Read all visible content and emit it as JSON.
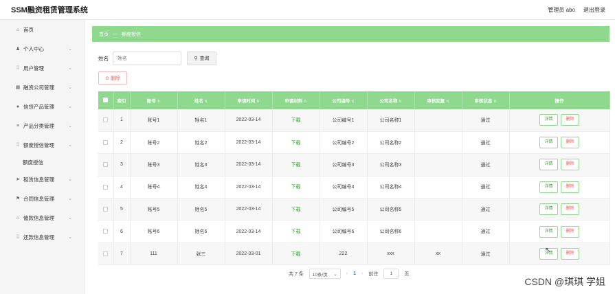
{
  "app": {
    "title": "SSM融资租赁管理系统"
  },
  "topbar": {
    "user": "管理员 abo",
    "logout": "退出登录"
  },
  "sidebar": {
    "items": [
      {
        "label": "首页",
        "icon": "home-icon",
        "glyph": "⌂",
        "chevron": false
      },
      {
        "label": "个人中心",
        "icon": "user-icon",
        "glyph": "♟",
        "chevron": true
      },
      {
        "label": "用户管理",
        "icon": "grid-icon",
        "glyph": "⁞⁞",
        "chevron": true
      },
      {
        "label": "融资公司管理",
        "icon": "building-icon",
        "glyph": "▦",
        "chevron": true
      },
      {
        "label": "信贷产品管理",
        "icon": "location-icon",
        "glyph": "●",
        "chevron": true
      },
      {
        "label": "产品分类管理",
        "icon": "list-icon",
        "glyph": "≡",
        "chevron": true
      },
      {
        "label": "额度授信管理",
        "icon": "grid-icon",
        "glyph": "⁞⁞",
        "chevron": true
      }
    ],
    "sub_item": "额度授信",
    "items2": [
      {
        "label": "租赁信息管理",
        "icon": "send-icon",
        "glyph": "➤",
        "chevron": true
      },
      {
        "label": "合同信息管理",
        "icon": "contract-icon",
        "glyph": "⚑",
        "chevron": true
      },
      {
        "label": "催款信息管理",
        "icon": "bank-icon",
        "glyph": "⌂",
        "chevron": true
      },
      {
        "label": "还款信息管理",
        "icon": "grid-icon",
        "glyph": "⁞⁞",
        "chevron": true
      }
    ]
  },
  "breadcrumb": {
    "home": "首页",
    "separator": "—",
    "current": "额度授信"
  },
  "search": {
    "label": "姓名",
    "placeholder": "姓名",
    "button": "查询"
  },
  "toolbar": {
    "delete_label": "删除"
  },
  "table": {
    "headers": [
      "索引",
      "账号",
      "姓名",
      "申请时间",
      "申请材料",
      "公司编号",
      "公司名称",
      "审核回复",
      "审核状态",
      "操作"
    ],
    "rows": [
      {
        "index": "1",
        "account": "账号1",
        "name": "姓名1",
        "time": "2022-03-14",
        "material": "下载",
        "company_no": "公司编号1",
        "company_name": "公司名称1",
        "reply": "",
        "status": "通过"
      },
      {
        "index": "2",
        "account": "账号2",
        "name": "姓名2",
        "time": "2022-03-14",
        "material": "下载",
        "company_no": "公司编号2",
        "company_name": "公司名称2",
        "reply": "",
        "status": "通过"
      },
      {
        "index": "3",
        "account": "账号3",
        "name": "姓名3",
        "time": "2022-03-14",
        "material": "下载",
        "company_no": "公司编号3",
        "company_name": "公司名称3",
        "reply": "",
        "status": "通过"
      },
      {
        "index": "4",
        "account": "账号4",
        "name": "姓名4",
        "time": "2022-03-14",
        "material": "下载",
        "company_no": "公司编号4",
        "company_name": "公司名称4",
        "reply": "",
        "status": "通过"
      },
      {
        "index": "5",
        "account": "账号5",
        "name": "姓名5",
        "time": "2022-03-14",
        "material": "下载",
        "company_no": "公司编号5",
        "company_name": "公司名称5",
        "reply": "",
        "status": "通过"
      },
      {
        "index": "6",
        "account": "账号6",
        "name": "姓名6",
        "time": "2022-03-14",
        "material": "下载",
        "company_no": "公司编号6",
        "company_name": "公司名称6",
        "reply": "",
        "status": "通过"
      },
      {
        "index": "7",
        "account": "111",
        "name": "张三",
        "time": "2022-03-01",
        "material": "下载",
        "company_no": "222",
        "company_name": "xxx",
        "reply": "xx",
        "status": "通过"
      }
    ],
    "detail_label": "详情",
    "delete_label": "删除"
  },
  "pagination": {
    "total": "共 7 条",
    "page_size": "10条/页",
    "prev": "‹",
    "current_page": "1",
    "next": "›",
    "goto_label": "前往",
    "goto_value": "1",
    "page_suffix": "页"
  },
  "watermark": "CSDN @琪琪 学姐",
  "colors": {
    "accent": "#8ed98e",
    "danger": "#e26060",
    "link": "#2c7be5"
  }
}
